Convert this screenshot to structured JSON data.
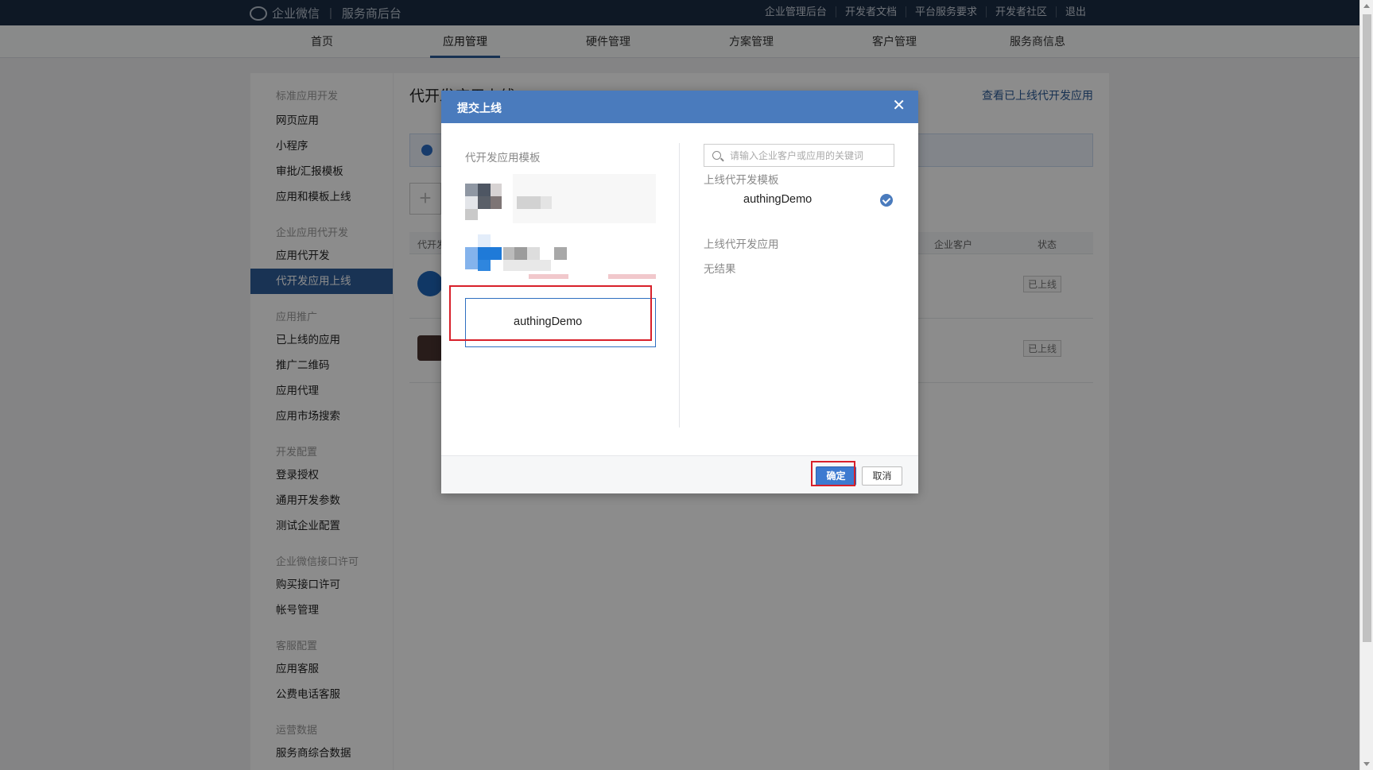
{
  "brand": {
    "logo_name": "企业微信",
    "product": "服务商后台"
  },
  "top_links": [
    "企业管理后台",
    "开发者文档",
    "平台服务要求",
    "开发者社区",
    "退出"
  ],
  "main_tabs": [
    {
      "label": "首页",
      "active": false
    },
    {
      "label": "应用管理",
      "active": true
    },
    {
      "label": "硬件管理",
      "active": false
    },
    {
      "label": "方案管理",
      "active": false
    },
    {
      "label": "客户管理",
      "active": false
    },
    {
      "label": "服务商信息",
      "active": false
    }
  ],
  "sidebar": {
    "groups": [
      {
        "title": "标准应用开发",
        "items": [
          "网页应用",
          "小程序",
          "审批/汇报模板",
          "应用和模板上线"
        ]
      },
      {
        "title": "企业应用代开发",
        "items": [
          "应用代开发",
          "代开发应用上线"
        ]
      },
      {
        "title": "应用推广",
        "items": [
          "已上线的应用",
          "推广二维码",
          "应用代理",
          "应用市场搜索"
        ]
      },
      {
        "title": "开发配置",
        "items": [
          "登录授权",
          "通用开发参数",
          "测试企业配置"
        ]
      },
      {
        "title": "企业微信接口许可",
        "items": [
          "购买接口许可",
          "帐号管理"
        ]
      },
      {
        "title": "客服配置",
        "items": [
          "应用客服",
          "公费电话客服"
        ]
      },
      {
        "title": "运营数据",
        "items": [
          "服务商综合数据"
        ]
      }
    ],
    "active_item": "代开发应用上线"
  },
  "content": {
    "title": "代开发应用上线",
    "top_link": "查看已上线代开发应用",
    "table_headers": [
      "代开发",
      "企业客户",
      "状态"
    ],
    "rows": [
      {
        "status": "已上线"
      },
      {
        "status": "已上线"
      }
    ]
  },
  "modal": {
    "title": "提交上线",
    "close_icon": "close-icon",
    "left_label": "代开发应用模板",
    "selected_template": "authingDemo",
    "search_placeholder": "请输入企业客户或应用的关键词",
    "right_template_label": "上线代开发模板",
    "right_selected": "authingDemo",
    "right_app_label": "上线代开发应用",
    "right_empty": "无结果",
    "ok_label": "确定",
    "cancel_label": "取消",
    "accent": "#4a7bbd",
    "highlight_color": "#d8202a"
  }
}
